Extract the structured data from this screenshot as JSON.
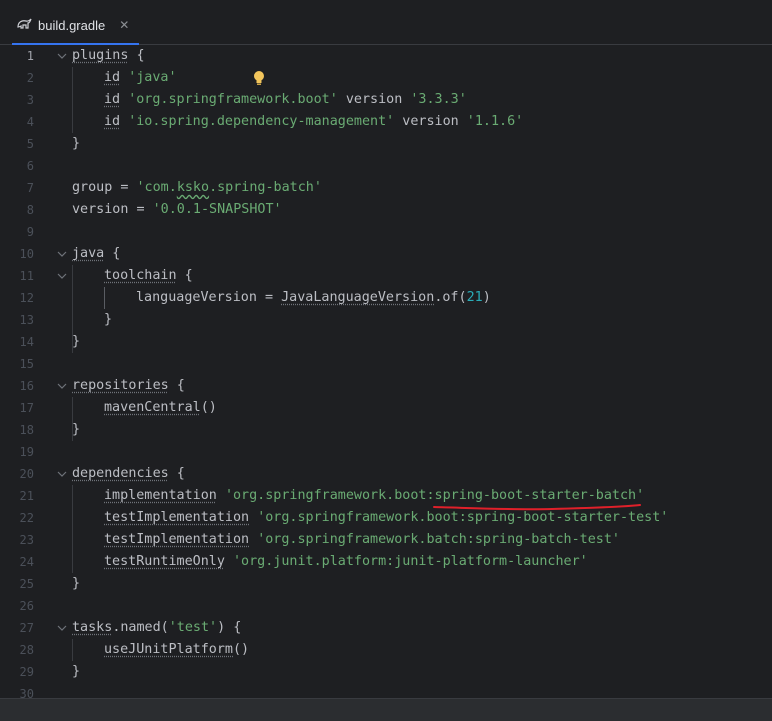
{
  "tab": {
    "title": "build.gradle",
    "close_icon": "close-icon",
    "file_icon": "gradle-elephant-icon"
  },
  "gutter": {
    "lines": [
      "1",
      "2",
      "3",
      "4",
      "5",
      "6",
      "7",
      "8",
      "9",
      "10",
      "11",
      "12",
      "13",
      "14",
      "15",
      "16",
      "17",
      "18",
      "19",
      "20",
      "21",
      "22",
      "23",
      "24",
      "25",
      "26",
      "27",
      "28",
      "29",
      "30"
    ]
  },
  "code": {
    "l1": {
      "a": "plugins",
      "b": " {"
    },
    "l2": {
      "a": "id",
      "b": " ",
      "c": "'java'"
    },
    "l3": {
      "a": "id",
      "b": " ",
      "c": "'org.springframework.boot'",
      "d": " version ",
      "e": "'3.3.3'"
    },
    "l4": {
      "a": "id",
      "b": " ",
      "c": "'io.spring.dependency-management'",
      "d": " version ",
      "e": "'1.1.6'"
    },
    "l5": {
      "a": "}"
    },
    "l7": {
      "a": "group",
      "b": " = ",
      "c": "'com.",
      "d": "ksko",
      "e": ".spring-batch'"
    },
    "l8": {
      "a": "version",
      "b": " = ",
      "c": "'0.0.1-SNAPSHOT'"
    },
    "l10": {
      "a": "java",
      "b": " {"
    },
    "l11": {
      "a": "toolchain",
      "b": " {"
    },
    "l12": {
      "a": "languageVersion",
      "b": " = ",
      "c": "JavaLanguageVersion",
      "d": ".of(",
      "e": "21",
      "f": ")"
    },
    "l13": {
      "a": "}"
    },
    "l14": {
      "a": "}"
    },
    "l16": {
      "a": "repositories",
      "b": " {"
    },
    "l17": {
      "a": "mavenCentral",
      "b": "()"
    },
    "l18": {
      "a": "}"
    },
    "l20": {
      "a": "dependencies",
      "b": " {"
    },
    "l21": {
      "a": "implementation",
      "b": " ",
      "c": "'org.springframework.boot:spring-boot-starter-batch'"
    },
    "l22": {
      "a": "testImplementation",
      "b": " ",
      "c": "'org.springframework.boot:spring-boot-starter-test'"
    },
    "l23": {
      "a": "testImplementation",
      "b": " ",
      "c": "'org.springframework.batch:spring-batch-test'"
    },
    "l24": {
      "a": "testRuntimeOnly",
      "b": " ",
      "c": "'org.junit.platform:junit-platform-launcher'"
    },
    "l25": {
      "a": "}"
    },
    "l27": {
      "a": "tasks",
      "b": ".named(",
      "c": "'test'",
      "d": ") {"
    },
    "l28": {
      "a": "useJUnitPlatform",
      "b": "()"
    },
    "l29": {
      "a": "}"
    }
  },
  "colors": {
    "background": "#1e1f22",
    "string": "#6aab73",
    "number": "#2aacb8",
    "text": "#bcbec4",
    "line_number": "#4b5059",
    "annotation_red": "#e0202a",
    "bulb": "#f2c55c"
  }
}
